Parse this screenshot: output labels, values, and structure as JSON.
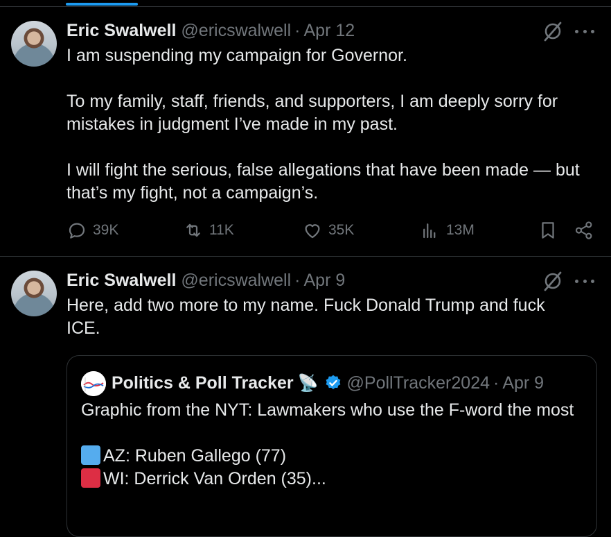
{
  "tweets": [
    {
      "author_name": "Eric Swalwell",
      "author_handle": "@ericswalwell",
      "separator": "·",
      "date": "Apr 12",
      "paragraphs": [
        "I am suspending my campaign for Governor.",
        "To my family, staff, friends, and supporters, I am deeply sorry for mistakes in judgment I’ve made in my past.",
        "I will fight the serious, false allegations that have been made — but that’s my fight, not a campaign’s."
      ],
      "replies": "39K",
      "reposts": "11K",
      "likes": "35K",
      "views": "13M"
    },
    {
      "author_name": "Eric Swalwell",
      "author_handle": "@ericswalwell",
      "separator": "·",
      "date": "Apr 9",
      "paragraphs": [
        "Here, add two more to my name. Fuck Donald Trump and fuck ICE."
      ],
      "quote": {
        "author_name": "Politics & Poll Tracker",
        "emoji": "📡",
        "author_handle": "@PollTracker2024",
        "separator": "·",
        "date": "Apr 9",
        "text_line": "Graphic from the NYT: Lawmakers who use the F-word the most",
        "list": [
          {
            "color": "#55acee",
            "label": "AZ: Ruben Gallego (77)"
          },
          {
            "color": "#dd2e44",
            "label": "WI: Derrick Van Orden (35)..."
          }
        ]
      }
    }
  ],
  "icons": {
    "reply": "reply-icon",
    "repost": "repost-icon",
    "like": "like-icon",
    "views": "views-icon",
    "bookmark": "bookmark-icon",
    "share": "share-icon",
    "grok": "grok-icon",
    "more": "more-icon",
    "verified": "verified-badge-icon"
  },
  "colors": {
    "background": "#000000",
    "text": "#e7e9ea",
    "muted": "#71767b",
    "accent": "#1d9bf0",
    "divider": "#2f3336"
  }
}
